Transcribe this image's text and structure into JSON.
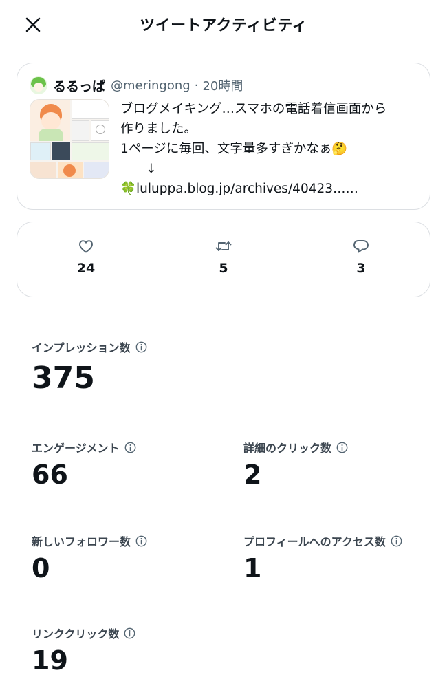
{
  "header": {
    "title": "ツイートアクティビティ",
    "close_icon": "close-icon"
  },
  "tweet": {
    "author_name": "るるっぱ",
    "handle": "@meringong",
    "separator": "·",
    "time": "20時間",
    "lines": [
      "ブログメイキング…スマホの電話着信画面から",
      "作りました。",
      "1ページに毎回、文字量多すぎかなぁ🤔",
      "　　↓",
      "🍀luluppa.blog.jp/archives/40423……"
    ]
  },
  "engagement": {
    "likes": {
      "icon": "heart-icon",
      "count": "24"
    },
    "retweets": {
      "icon": "retweet-icon",
      "count": "5"
    },
    "replies": {
      "icon": "reply-icon",
      "count": "3"
    }
  },
  "metrics": {
    "impressions": {
      "label": "インプレッション数",
      "value": "375"
    },
    "engagements": {
      "label": "エンゲージメント",
      "value": "66"
    },
    "detail_clicks": {
      "label": "詳細のクリック数",
      "value": "2"
    },
    "new_followers": {
      "label": "新しいフォロワー数",
      "value": "0"
    },
    "profile_visits": {
      "label": "プロフィールへのアクセス数",
      "value": "1"
    },
    "link_clicks": {
      "label": "リンククリック数",
      "value": "19"
    }
  },
  "colors": {
    "text": "#0f1419",
    "secondary": "#536471",
    "border": "#dcdfe3",
    "icon": "#536471"
  }
}
